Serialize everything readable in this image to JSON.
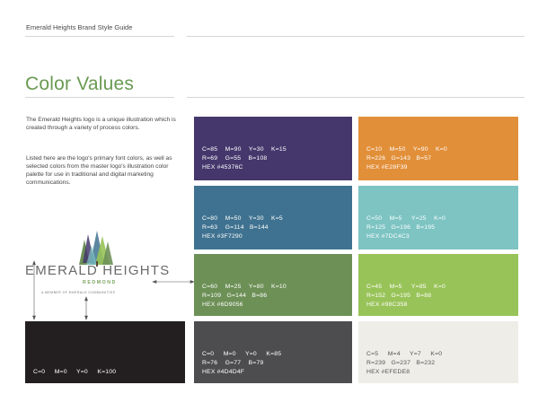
{
  "header": {
    "title": "Emerald Heights Brand Style Guide"
  },
  "section": {
    "title": "Color Values"
  },
  "intro": {
    "p1": "The Emerald Heights logo is a unique illustration which is created through a variety of process colors.",
    "p2": "Listed here are the logo's primary font colors, as well as selected colors from the master logo's illustration color palette for use in traditional and digital marketing communications."
  },
  "logo": {
    "name": "EMERALD HEIGHTS",
    "sub": "REDMOND",
    "tagline": "A MEMBER OF EMERALD COMMUNITIES"
  },
  "black_swatch": {
    "cmyk": "C=0     M=0     Y=0     K=100",
    "color": "#231F20"
  },
  "swatches": [
    {
      "cmyk": "C=85    M=90    Y=30    K=15",
      "rgb": "R=69    G=55    B=108",
      "hex": "HEX #45376C",
      "color": "#45376C"
    },
    {
      "cmyk": "C=10    M=50    Y=90    K=0",
      "rgb": "R=226   G=143   B=57",
      "hex": "HEX #E28F39",
      "color": "#E28F39"
    },
    {
      "cmyk": "C=80    M=50    Y=30    K=5",
      "rgb": "R=63    G=114   B=144",
      "hex": "HEX #3F7290",
      "color": "#3F7290"
    },
    {
      "cmyk": "C=50    M=5     Y=25    K=0",
      "rgb": "R=125   G=196   B=195",
      "hex": "HEX #7DC4C3",
      "color": "#7DC4C3"
    },
    {
      "cmyk": "C=60    M=25    Y=80    K=10",
      "rgb": "R=109   G=144   B=86",
      "hex": "HEX #6D9056",
      "color": "#6D9056"
    },
    {
      "cmyk": "C=45    M=5     Y=85    K=0",
      "rgb": "R=152   G=195   B=88",
      "hex": "HEX #98C358",
      "color": "#98C358"
    },
    {
      "cmyk": "C=0     M=0     Y=0     K=85",
      "rgb": "R=76    G=77    B=79",
      "hex": "HEX #4D4D4F",
      "color": "#4D4D4F"
    },
    {
      "cmyk": "C=5     M=4     Y=7     K=0",
      "rgb": "R=239   G=237   B=232",
      "hex": "HEX #EFEDE8",
      "color": "#EFEDE8"
    }
  ]
}
